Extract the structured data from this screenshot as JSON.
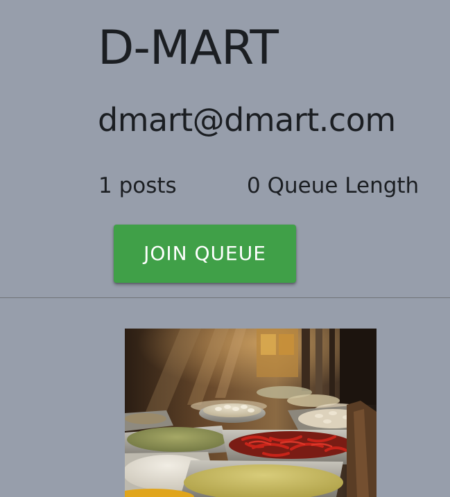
{
  "profile": {
    "name": "D-MART",
    "email": "dmart@dmart.com",
    "stats": {
      "posts_label": "1 posts",
      "queue_label": "0 Queue Length"
    },
    "join_button_label": "JOIN QUEUE"
  },
  "posts": [
    {
      "image": {
        "subject": "spice-market-photo"
      }
    }
  ],
  "colors": {
    "background": "#979eab",
    "accent": "#40a048",
    "text": "#1b1e22",
    "divider": "#6f7378"
  }
}
